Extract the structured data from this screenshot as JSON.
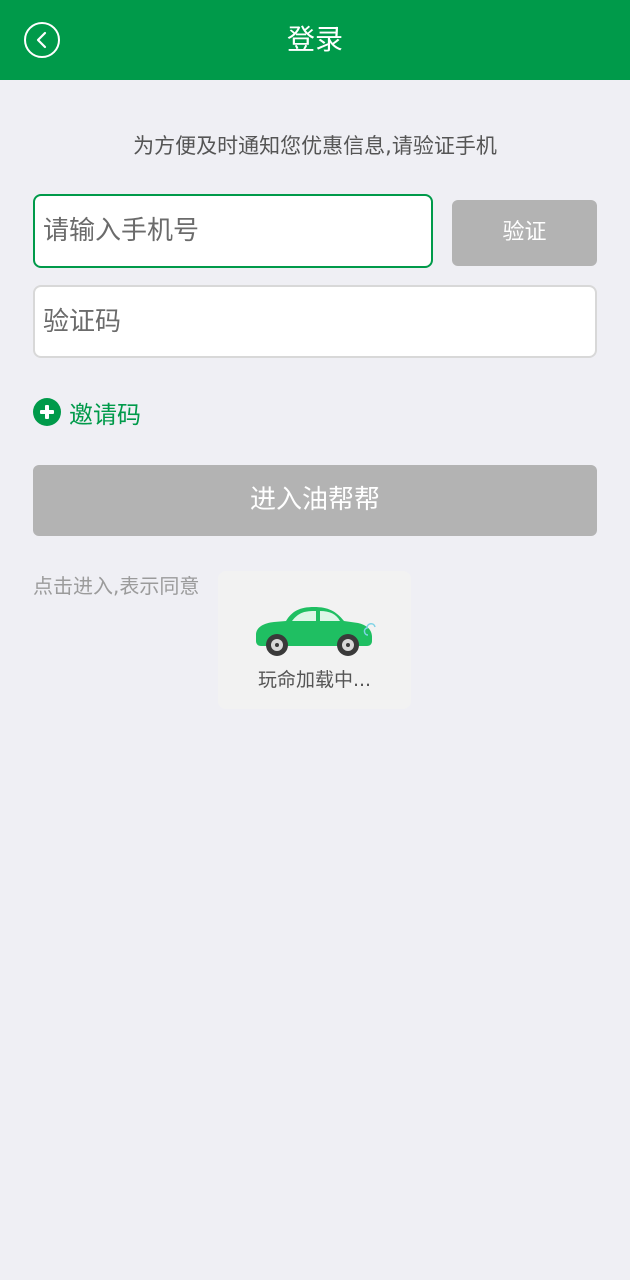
{
  "header": {
    "title": "登录",
    "back_icon": "chevron-left-circle-icon",
    "color": "#009a4a"
  },
  "notice": "为方便及时通知您优惠信息,请验证手机",
  "phone": {
    "placeholder": "请输入手机号",
    "value": ""
  },
  "verify_button": "验证",
  "code": {
    "placeholder": "验证码",
    "value": ""
  },
  "invite": {
    "icon": "plus-circle-icon",
    "label": "邀请码"
  },
  "enter_button": "进入油帮帮",
  "agree_text": "点击进入,表示同意",
  "loading": {
    "icon": "car-icon",
    "text": "玩命加载中..."
  }
}
